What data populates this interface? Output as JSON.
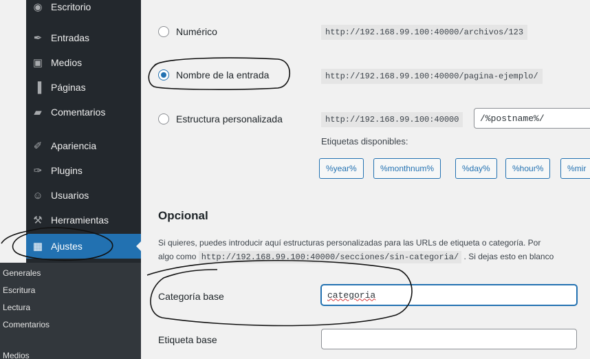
{
  "sidebar": {
    "items": [
      {
        "label": "Escritorio",
        "icon": "dashboard-icon",
        "glyph": "◉"
      },
      {
        "label": "Entradas",
        "icon": "pin-icon",
        "glyph": "✒"
      },
      {
        "label": "Medios",
        "icon": "media-icon",
        "glyph": "▣"
      },
      {
        "label": "Páginas",
        "icon": "pages-icon",
        "glyph": "▐"
      },
      {
        "label": "Comentarios",
        "icon": "comment-icon",
        "glyph": "▰"
      },
      {
        "label": "Apariencia",
        "icon": "brush-icon",
        "glyph": "✐"
      },
      {
        "label": "Plugins",
        "icon": "plugin-icon",
        "glyph": "✑"
      },
      {
        "label": "Usuarios",
        "icon": "user-icon",
        "glyph": "☺"
      },
      {
        "label": "Herramientas",
        "icon": "wrench-icon",
        "glyph": "⚒"
      },
      {
        "label": "Ajustes",
        "icon": "settings-icon",
        "glyph": "▦"
      }
    ],
    "submenu": [
      "Generales",
      "Escritura",
      "Lectura",
      "Comentarios",
      "Medios"
    ]
  },
  "permalinks": {
    "numeric_label": "Numérico",
    "numeric_example": "http://192.168.99.100:40000/archivos/123",
    "postname_label": "Nombre de la entrada",
    "postname_example": "http://192.168.99.100:40000/pagina-ejemplo/",
    "custom_label": "Estructura personalizada",
    "custom_prefix": "http://192.168.99.100:40000",
    "custom_value": "/%postname%/",
    "available_tags_label": "Etiquetas disponibles:",
    "tags": [
      "%year%",
      "%monthnum%",
      "%day%",
      "%hour%",
      "%mir"
    ]
  },
  "optional": {
    "title": "Opcional",
    "desc_line1": "Si quieres, puedes introducir aquí estructuras personalizadas para las URLs de etiqueta o categoría. Por",
    "desc_line2_pre": "algo como",
    "desc_line2_code": "http://192.168.99.100:40000/secciones/sin-categoria/",
    "desc_line2_post": ". Si dejas esto en blanco",
    "category_base_label": "Categoría base",
    "category_base_value": "categoria",
    "tag_base_label": "Etiqueta base",
    "tag_base_value": ""
  },
  "colors": {
    "accent": "#2271b1",
    "sidebar_bg": "#23282d",
    "submenu_bg": "#32373c",
    "content_bg": "#f1f1f1"
  }
}
